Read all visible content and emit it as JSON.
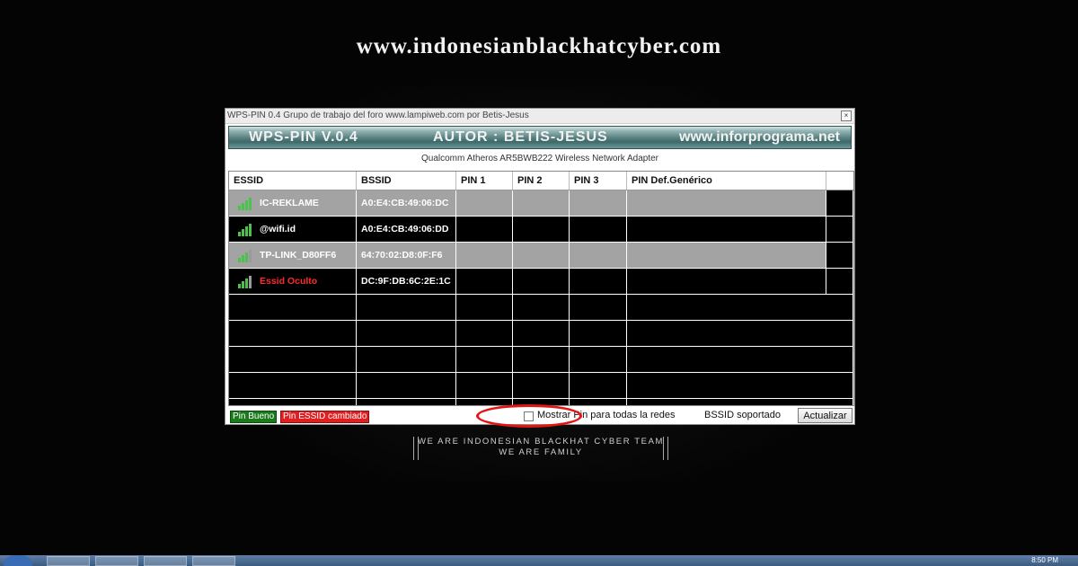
{
  "site_title": "www.indonesianblackhatcyber.com",
  "window": {
    "title": "WPS-PIN 0.4 Grupo de trabajo del foro www.lampiweb.com por Betis-Jesus",
    "close_icon": "close-icon"
  },
  "banner": {
    "left": "WPS-PIN V.0.4",
    "center": "AUTOR : BETIS-JESUS",
    "right": "www.inforprograma.net"
  },
  "adapter": "Qualcomm Atheros AR5BWB222 Wireless Network Adapter",
  "table": {
    "headers": [
      "ESSID",
      "BSSID",
      "PIN 1",
      "PIN 2",
      "PIN 3",
      "PIN Def.Genérico"
    ],
    "rows": [
      {
        "essid": "IC-REKLAME",
        "bssid": "A0:E4:CB:49:06:DC",
        "signal_icon": "signal-bars-icon"
      },
      {
        "essid": "@wifi.id",
        "bssid": "A0:E4:CB:49:06:DD",
        "signal_icon": "signal-bars-icon"
      },
      {
        "essid": "TP-LINK_D80FF6",
        "bssid": "64:70:02:D8:0F:F6",
        "signal_icon": "signal-bars-icon"
      },
      {
        "essid": "Essid Oculto",
        "bssid": "DC:9F:DB:6C:2E:1C",
        "signal_icon": "signal-bars-icon"
      }
    ]
  },
  "status": {
    "pin_good": "Pin Bueno",
    "pin_changed": "Pin ESSID cambiado",
    "mostrar": "Mostrar Pin para todas la redes",
    "bssid_supported": "BSSID soportado",
    "refresh": "Actualizar"
  },
  "team": {
    "line1": "WE ARE INDONESIAN BLACKHAT CYBER TEAM",
    "line2": "WE ARE FAMILY"
  },
  "taskbar": {
    "clock": "8:50 PM"
  },
  "colors": {
    "accent_red": "#e31414",
    "row_grey": "#a3a3a3",
    "pin_good": "#1b7a1b",
    "pin_changed": "#e02020",
    "signal_green": "#4cc24c"
  }
}
